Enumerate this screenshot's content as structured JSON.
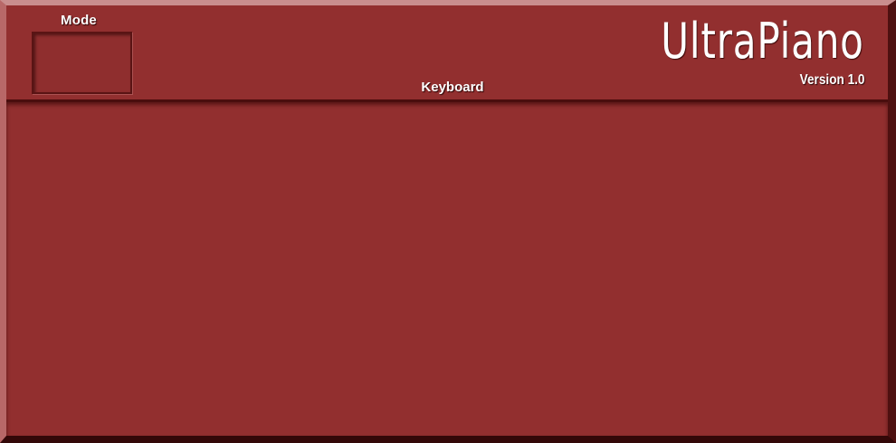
{
  "app": {
    "title": "UltraPiano",
    "version": "Version 1.0"
  },
  "mode": {
    "label": "Mode"
  },
  "keyboard": {
    "label": "Keyboard"
  },
  "colors": {
    "panel": "#922f2f",
    "text": "#ffffff",
    "bevel_light": "#c98e8e",
    "bevel_dark": "#330808"
  }
}
